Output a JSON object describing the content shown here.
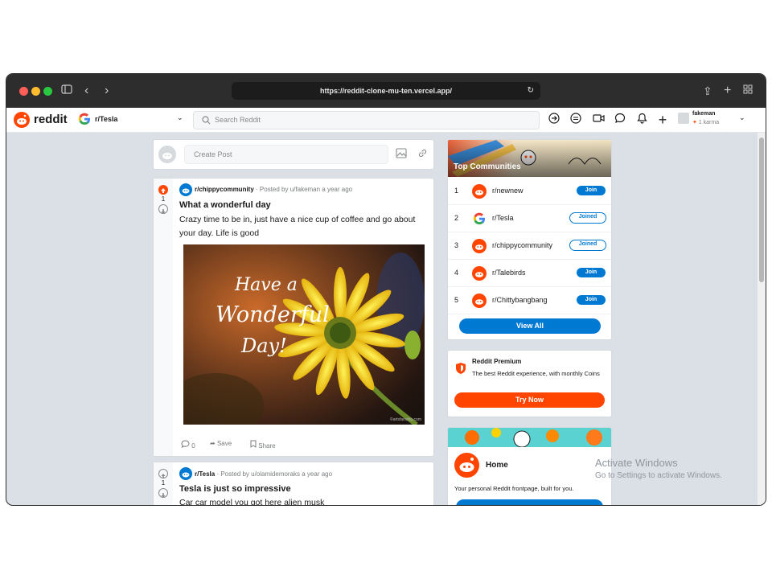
{
  "browser": {
    "url": "https://reddit-clone-mu-ten.vercel.app/"
  },
  "navbar": {
    "logo_text": "reddit",
    "community": "r/Tesla",
    "search_placeholder": "Search Reddit",
    "username": "fakeman",
    "karma": "1 karma"
  },
  "create_post": {
    "placeholder": "Create Post"
  },
  "posts": [
    {
      "subreddit": "r/chippycommunity",
      "meta": "· Posted by u/fakeman a year ago",
      "votes": "1",
      "title": "What a wonderful day",
      "body": "Crazy time to be in, just have a nice cup of coffee and go about your day. Life is good",
      "image_text_line1": "Have a",
      "image_text_line2": "Wonderful",
      "image_text_line3": "Day!",
      "image_credit": "©artsfairship.com",
      "comments": "0",
      "save_label": "Save",
      "share_label": "Share"
    },
    {
      "subreddit": "r/Tesla",
      "meta": "· Posted by u/olamidemoraks a year ago",
      "votes": "1",
      "title": "Tesla is just so impressive",
      "body": "Car car model you got here alien musk"
    }
  ],
  "top_communities": {
    "header": "Top Communities",
    "items": [
      {
        "rank": "1",
        "name": "r/newnew",
        "status": "Join"
      },
      {
        "rank": "2",
        "name": "r/Tesla",
        "status": "Joined"
      },
      {
        "rank": "3",
        "name": "r/chippycommunity",
        "status": "Joined"
      },
      {
        "rank": "4",
        "name": "r/Talebirds",
        "status": "Join"
      },
      {
        "rank": "5",
        "name": "r/Chittybangbang",
        "status": "Join"
      }
    ],
    "view_all": "View All"
  },
  "premium": {
    "title": "Reddit Premium",
    "description": "The best Reddit experience, with monthly Coins",
    "button": "Try Now"
  },
  "home_card": {
    "title": "Home",
    "description": "Your personal Reddit frontpage, built for you."
  },
  "watermark": {
    "line1": "Activate Windows",
    "line2": "Go to Settings to activate Windows."
  },
  "colors": {
    "brand": "#ff4500",
    "accent": "#0079d3",
    "background": "#dae0e6"
  }
}
